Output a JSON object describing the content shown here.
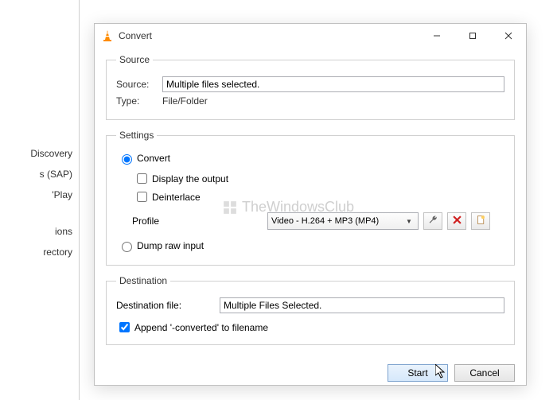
{
  "bg": {
    "items": [
      "Discovery",
      "s (SAP)",
      "'Play",
      "",
      "ions",
      "rectory"
    ]
  },
  "dialog": {
    "title": "Convert",
    "source": {
      "legend": "Source",
      "source_label": "Source:",
      "source_value": "Multiple files selected.",
      "type_label": "Type:",
      "type_value": "File/Folder"
    },
    "settings": {
      "legend": "Settings",
      "convert_label": "Convert",
      "display_output_label": "Display the output",
      "deinterlace_label": "Deinterlace",
      "profile_label": "Profile",
      "profile_value": "Video - H.264 + MP3 (MP4)",
      "dump_label": "Dump raw input"
    },
    "destination": {
      "legend": "Destination",
      "file_label": "Destination file:",
      "file_value": "Multiple Files Selected.",
      "append_label": "Append '-converted' to filename"
    },
    "buttons": {
      "start": "Start",
      "cancel": "Cancel"
    }
  },
  "watermark": "TheWindowsClub"
}
